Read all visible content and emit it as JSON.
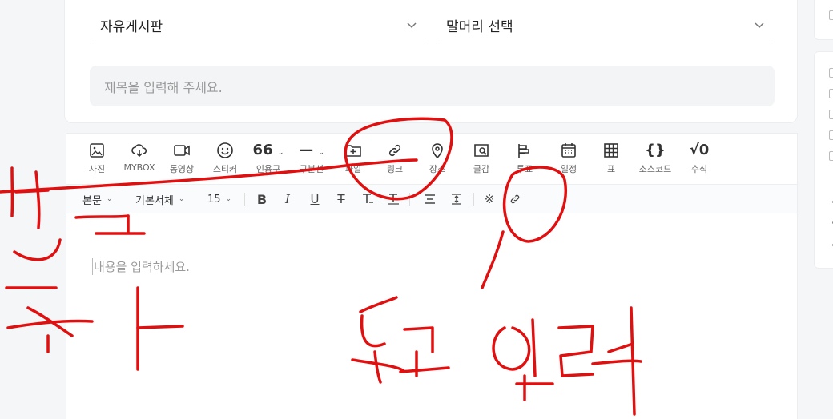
{
  "header": {
    "board_select": {
      "value": "자유게시판"
    },
    "prefix_select": {
      "value": "말머리 선택"
    },
    "title_input": {
      "placeholder": "제목을 입력해 주세요."
    }
  },
  "toolbar": {
    "tools": [
      {
        "label": "사진",
        "icon": "image-icon"
      },
      {
        "label": "MYBOX",
        "icon": "cloud-download-icon"
      },
      {
        "label": "동영상",
        "icon": "video-icon"
      },
      {
        "label": "스티커",
        "icon": "smiley-icon"
      },
      {
        "label": "인용구",
        "icon": "quote-icon",
        "glyph": "66"
      },
      {
        "label": "구분선",
        "icon": "divider-icon",
        "glyph": "—"
      },
      {
        "label": "파일",
        "icon": "file-add-icon"
      },
      {
        "label": "링크",
        "icon": "link-icon"
      },
      {
        "label": "장소",
        "icon": "location-pin-icon"
      },
      {
        "label": "글감",
        "icon": "search-doc-icon"
      },
      {
        "label": "투표",
        "icon": "poll-icon"
      },
      {
        "label": "일정",
        "icon": "calendar-icon"
      },
      {
        "label": "표",
        "icon": "table-icon"
      },
      {
        "label": "소스코드",
        "icon": "code-braces-icon",
        "glyph": "{}"
      },
      {
        "label": "수식",
        "icon": "formula-icon",
        "glyph": "√0"
      }
    ]
  },
  "format_bar": {
    "paragraph_style": "본문",
    "font_family": "기본서체",
    "font_size": "15",
    "bold": "B",
    "italic": "I",
    "underline": "U",
    "strike": "T",
    "special_char": "※"
  },
  "editor": {
    "content_placeholder": "내용을 입력하세요."
  },
  "colors": {
    "annotation": "#e01010",
    "background": "#f5f6f8",
    "input_bg": "#f3f4f6"
  }
}
